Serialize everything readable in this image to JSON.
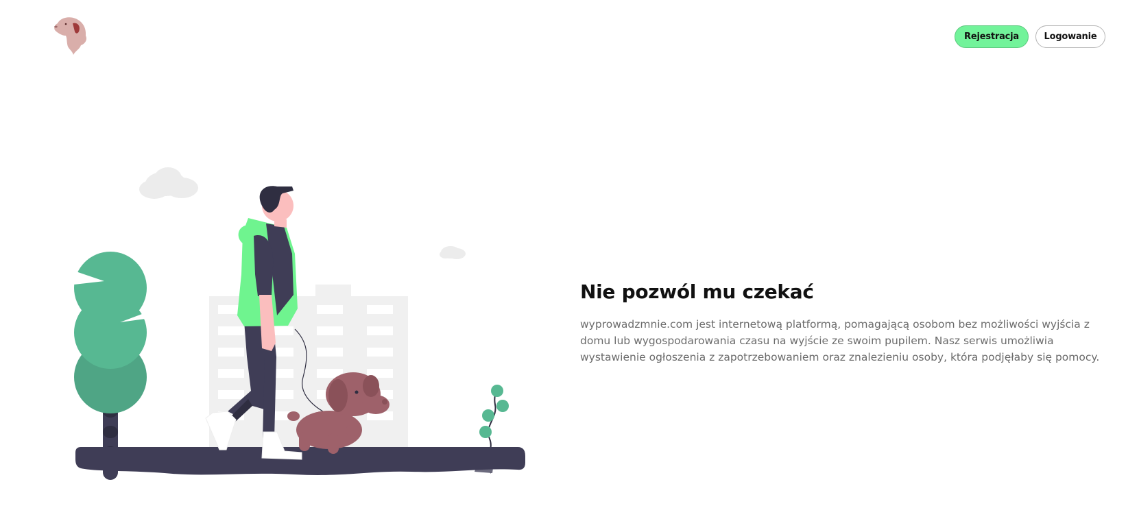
{
  "header": {
    "logo_icon": "dog-head-icon",
    "register_label": "Rejestracja",
    "login_label": "Logowanie",
    "accent_color": "#72f39a"
  },
  "hero": {
    "title": "Nie pozwól mu czekać",
    "description": "wyprowadzmnie.com jest internetową platformą, pomagającą osobom bez możliwości wyjścia z domu lub wygospodarowania czasu na wyjście ze swoim pupilem. Nasz serwis umożliwia wystawienie ogłoszenia z zapotrzebowaniem oraz znalezieniu osoby, która podjęłaby się pomocy.",
    "illustration_icon": "person-walking-dog-illustration"
  }
}
